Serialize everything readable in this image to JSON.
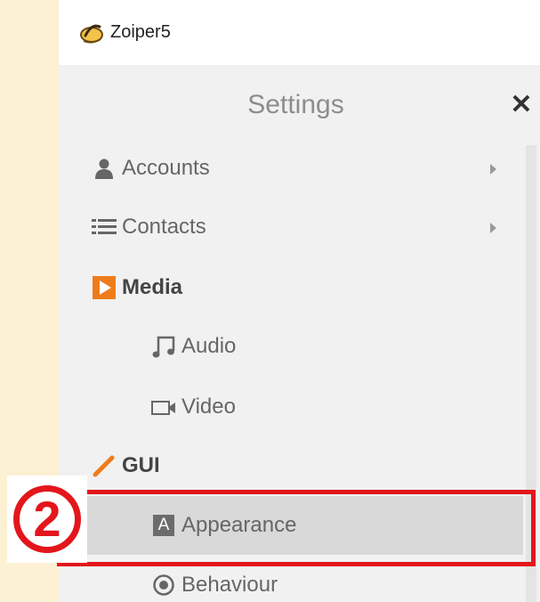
{
  "window": {
    "title": "Zoiper5"
  },
  "settings": {
    "title": "Settings",
    "close_icon": "close-icon"
  },
  "menu": {
    "accounts": {
      "label": "Accounts",
      "icon": "person-icon"
    },
    "contacts": {
      "label": "Contacts",
      "icon": "list-icon"
    },
    "media": {
      "label": "Media",
      "icon": "play-icon"
    },
    "audio": {
      "label": "Audio",
      "icon": "music-note-icon"
    },
    "video": {
      "label": "Video",
      "icon": "video-camera-icon"
    },
    "gui": {
      "label": "GUI",
      "icon": "pencil-icon"
    },
    "appearance": {
      "label": "Appearance",
      "icon": "letter-a-icon",
      "icon_text": "A"
    },
    "behaviour": {
      "label": "Behaviour",
      "icon": "radio-icon"
    }
  },
  "annotation": {
    "step": "②",
    "color": "#e3161c"
  }
}
